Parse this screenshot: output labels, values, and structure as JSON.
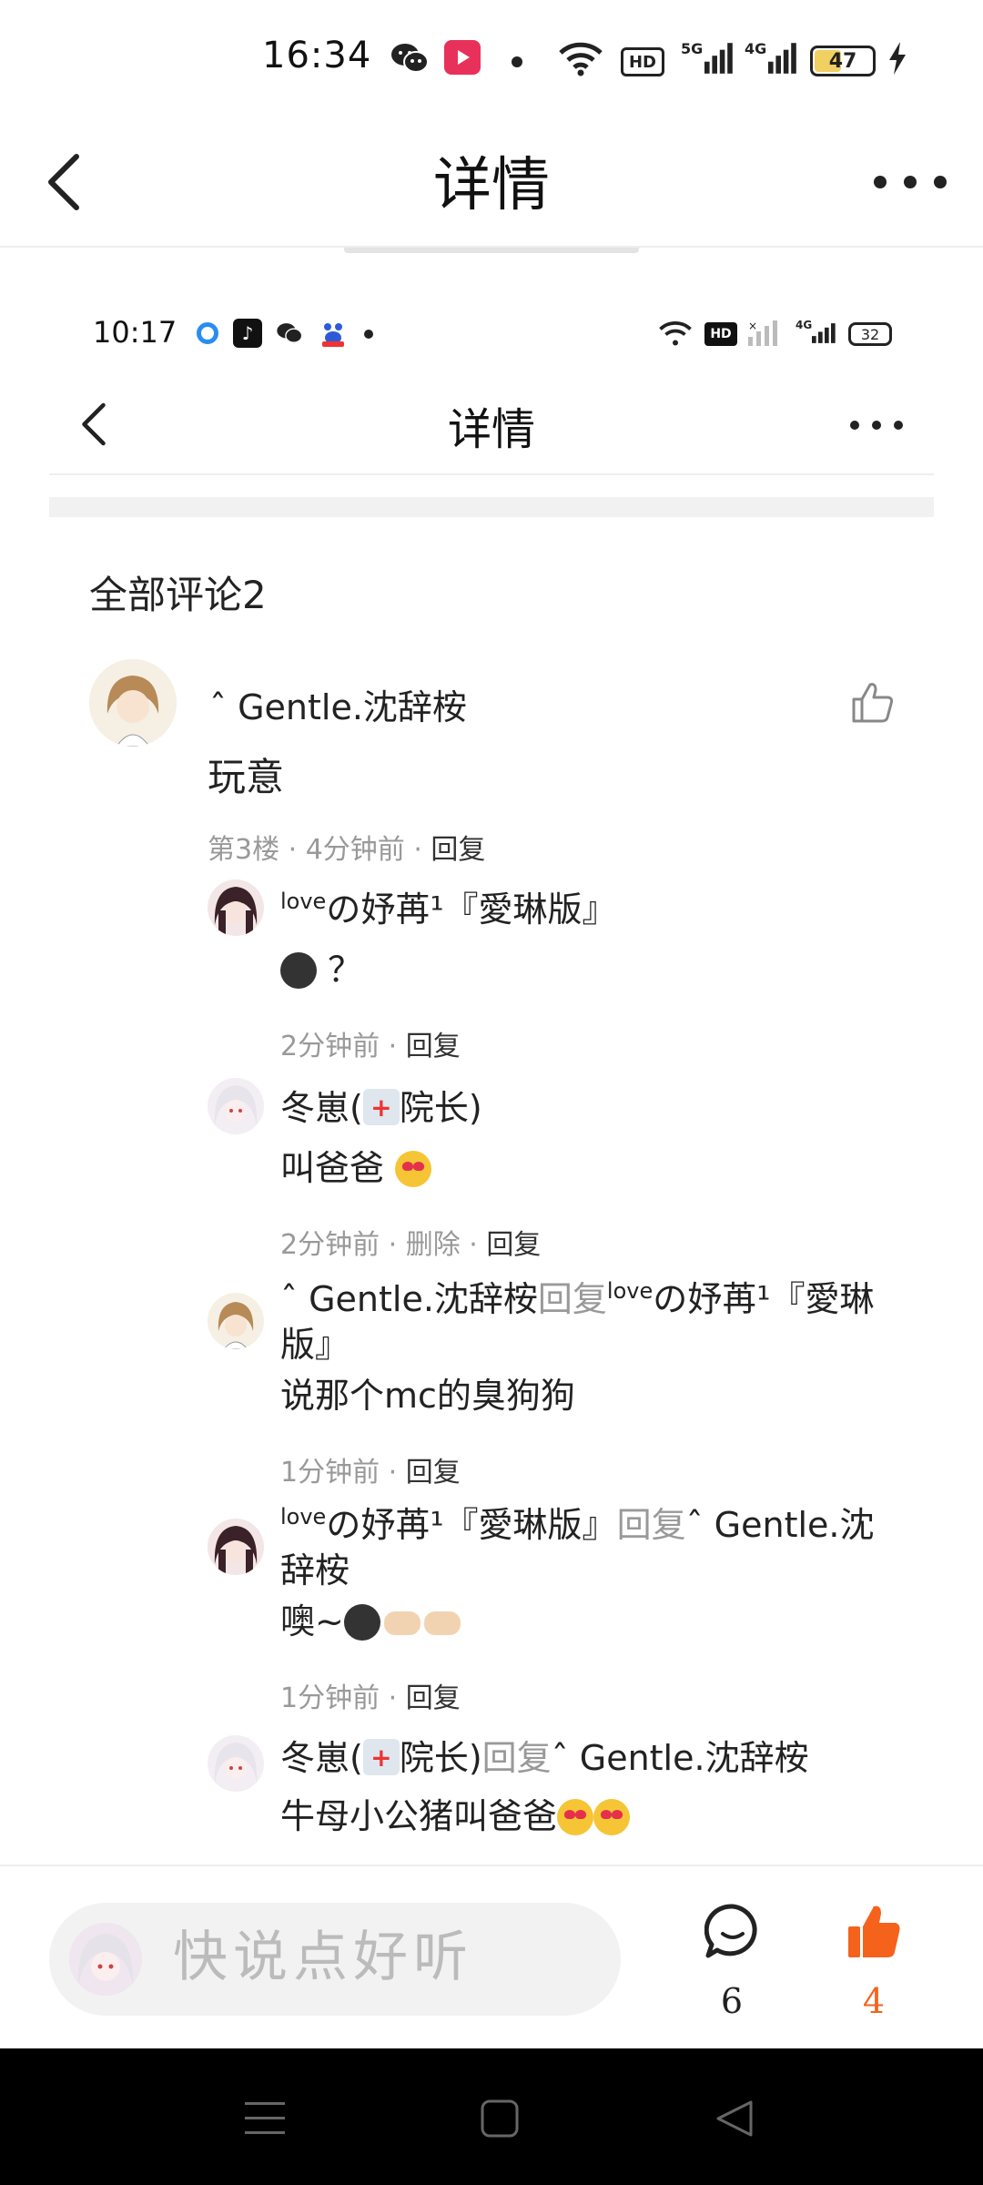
{
  "status_bar": {
    "time": "16:34",
    "hd_label": "HD",
    "net_5g": "5G",
    "net_4g": "4G",
    "battery": "47"
  },
  "header": {
    "title": "详情"
  },
  "inner": {
    "status_time": "10:17",
    "hd_label": "HD",
    "net_4g": "4G",
    "battery": "32",
    "title": "详情"
  },
  "section_title": "全部评论2",
  "main_comment": {
    "author": "ˆ Gentle.沈辞桉",
    "text": "玩意",
    "meta_prefix": "第3楼 · 4分钟前 · ",
    "reply_label": "回复"
  },
  "replies": [
    {
      "name_pre": "",
      "name_sup": "love",
      "name_main": "の妤苒¹『愛琳版』",
      "reply_word": "",
      "target_sup": "",
      "target": "",
      "text": "？",
      "meta": "2分钟前 · ",
      "reply_label": "回复"
    },
    {
      "name_main": "冬崽(",
      "name_post": "院长)",
      "text": "叫爸爸",
      "meta": "2分钟前 · 删除 · ",
      "reply_label": "回复"
    },
    {
      "name_main": "ˆ Gentle.沈辞桉",
      "reply_word": "回复",
      "target_sup": "love",
      "target": "の妤苒¹『愛琳版』",
      "text": "说那个mc的臭狗狗",
      "meta": "1分钟前 · ",
      "reply_label": "回复"
    },
    {
      "name_sup": "love",
      "name_main": "の妤苒¹『愛琳版』",
      "reply_word": "回复",
      "target": "ˆ Gentle.沈辞桉",
      "text": "噢~",
      "meta": "1分钟前 · ",
      "reply_label": "回复"
    },
    {
      "name_main": "冬崽(",
      "name_post": "院长)",
      "reply_word": "回复",
      "target": "ˆ Gentle.沈辞桉",
      "text": "牛母小公猪叫爸爸"
    }
  ],
  "bottom_bar": {
    "placeholder": "快说点好听的",
    "comment_count": "6",
    "like_count": "4"
  },
  "colors": {
    "accent": "#f5621c",
    "meta_gray": "#999999"
  }
}
